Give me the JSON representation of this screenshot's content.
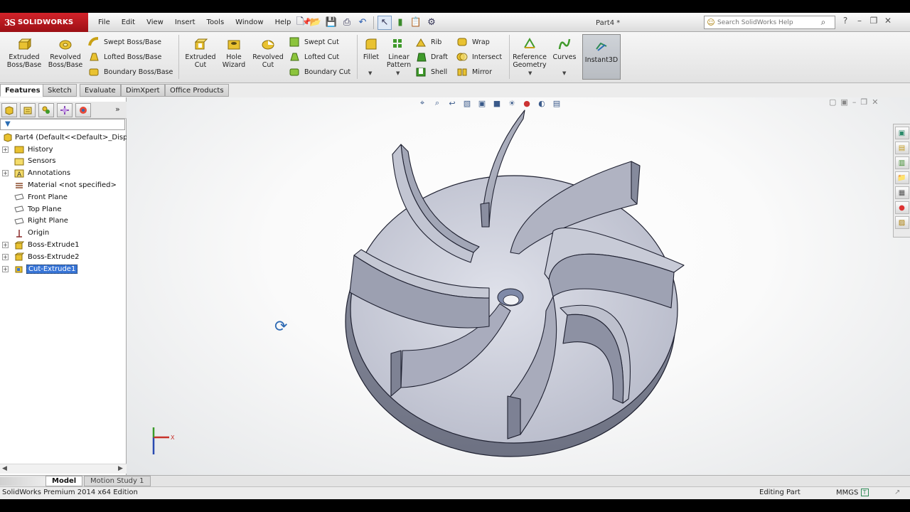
{
  "app": {
    "brand": "SOLIDWORKS",
    "logo_mark": "3S",
    "document_title": "Part4 *"
  },
  "menu": [
    "File",
    "Edit",
    "View",
    "Insert",
    "Tools",
    "Window",
    "Help"
  ],
  "search": {
    "placeholder": "Search SolidWorks Help"
  },
  "ribbon": {
    "extruded_boss": "Extruded\nBoss/Base",
    "revolved_boss": "Revolved\nBoss/Base",
    "swept_boss": "Swept Boss/Base",
    "lofted_boss": "Lofted Boss/Base",
    "boundary_boss": "Boundary Boss/Base",
    "extruded_cut": "Extruded\nCut",
    "hole_wizard": "Hole\nWizard",
    "revolved_cut": "Revolved\nCut",
    "swept_cut": "Swept Cut",
    "lofted_cut": "Lofted Cut",
    "boundary_cut": "Boundary Cut",
    "fillet": "Fillet",
    "linear_pattern": "Linear\nPattern",
    "rib": "Rib",
    "draft": "Draft",
    "shell": "Shell",
    "wrap": "Wrap",
    "intersect": "Intersect",
    "mirror": "Mirror",
    "reference_geometry": "Reference\nGeometry",
    "curves": "Curves",
    "instant3d": "Instant3D"
  },
  "command_tabs": [
    "Features",
    "Sketch",
    "Evaluate",
    "DimXpert",
    "Office Products"
  ],
  "tree": {
    "root": "Part4  (Default<<Default>_Disp",
    "items": [
      "History",
      "Sensors",
      "Annotations",
      "Material <not specified>",
      "Front Plane",
      "Top Plane",
      "Right Plane",
      "Origin",
      "Boss-Extrude1",
      "Boss-Extrude2",
      "Cut-Extrude1"
    ]
  },
  "bottom_tabs": [
    "Model",
    "Motion Study 1"
  ],
  "status": {
    "edition": "SolidWorks Premium 2014 x64 Edition",
    "mode": "Editing Part",
    "units": "MMGS"
  },
  "triad": {
    "x_label": "X"
  },
  "colors": {
    "accent": "#d2232a",
    "selection": "#3875d7",
    "part_face": "#c9ccd8",
    "part_edge": "#1e2030"
  }
}
